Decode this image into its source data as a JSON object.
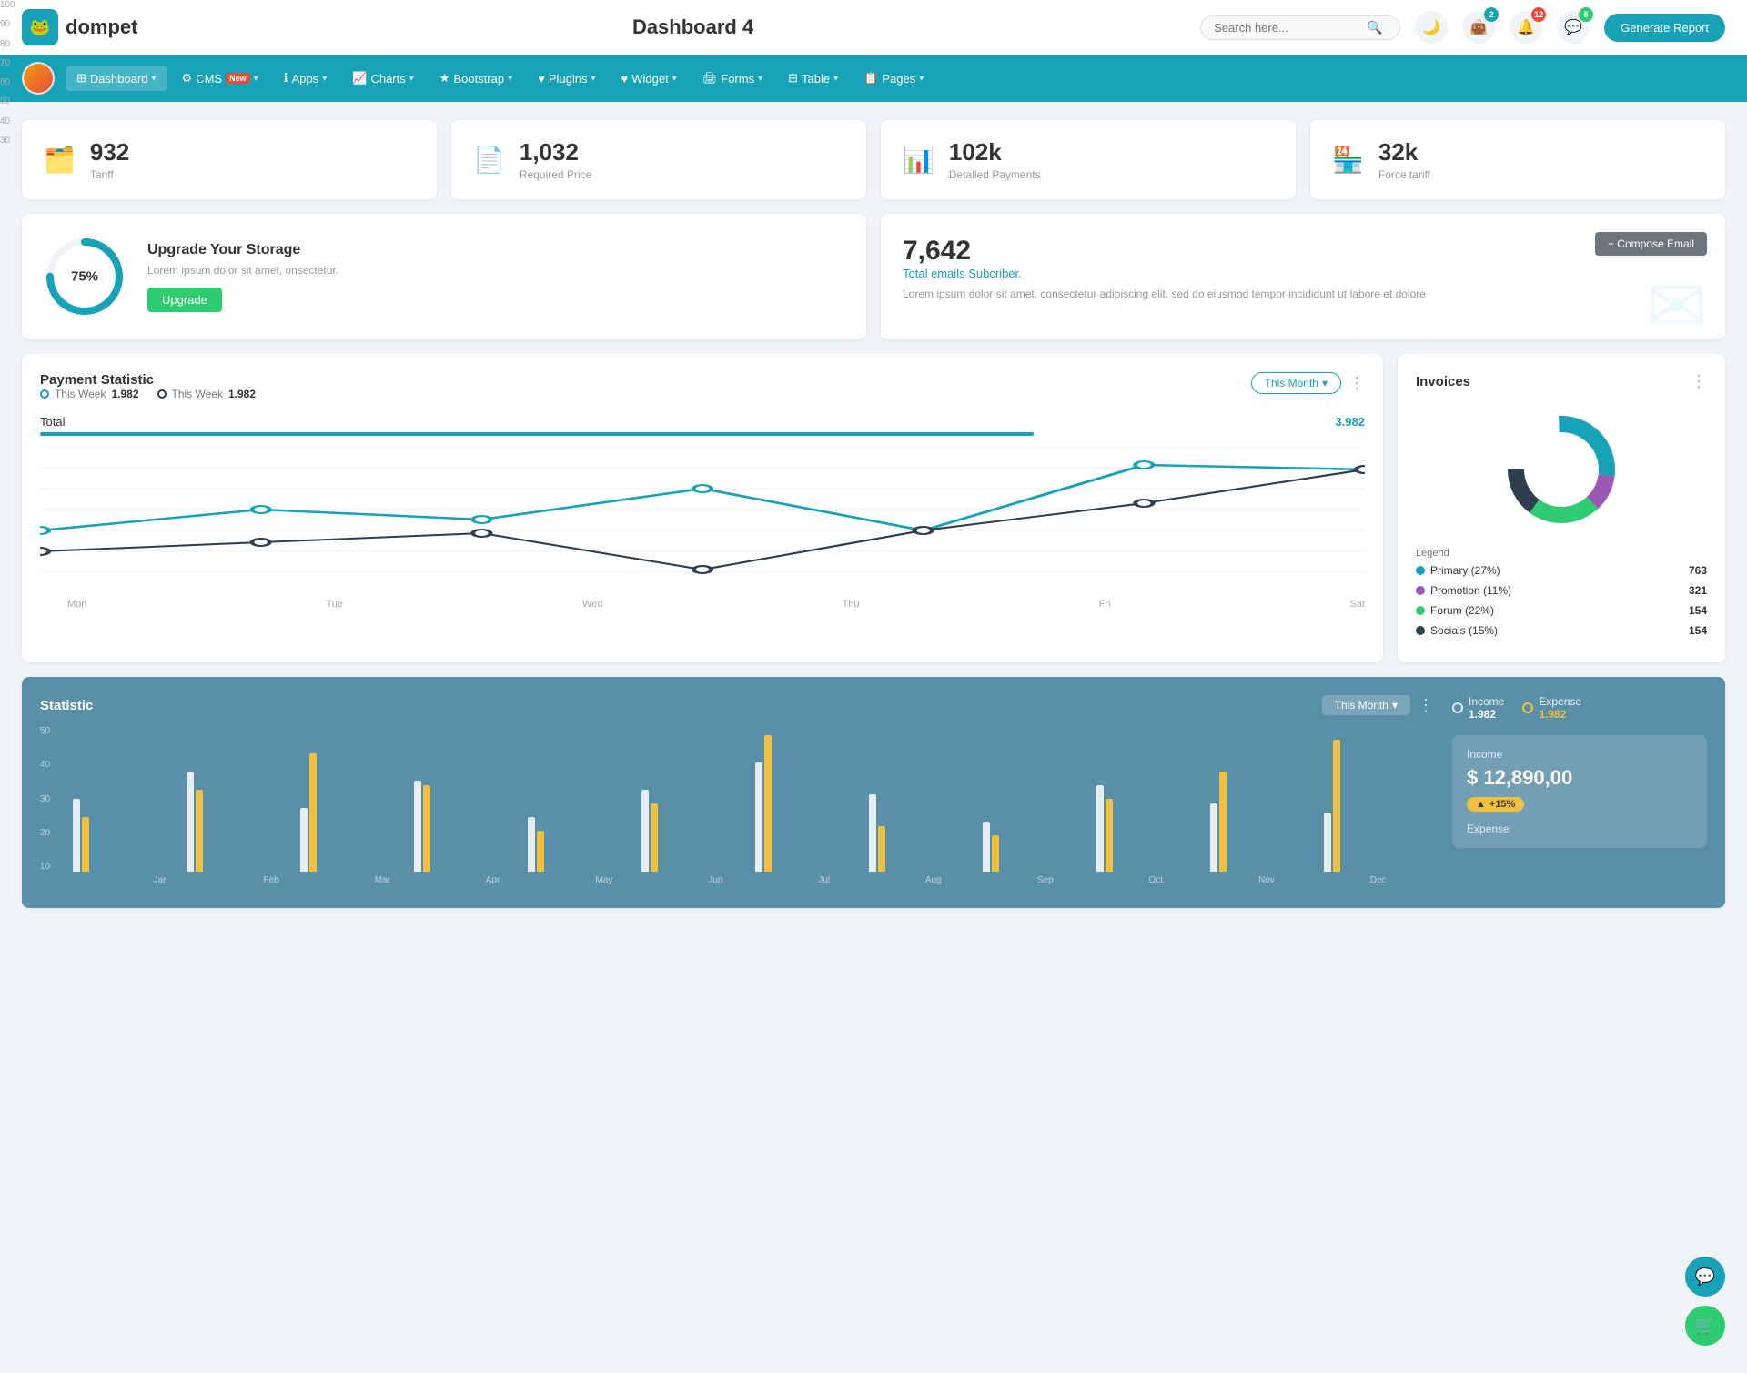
{
  "header": {
    "logo_text": "dompet",
    "title": "Dashboard 4",
    "search_placeholder": "Search here...",
    "generate_btn": "Generate Report",
    "icons": {
      "bag_badge": "2",
      "bell_badge": "12",
      "chat_badge": "5"
    }
  },
  "navbar": {
    "items": [
      {
        "id": "dashboard",
        "label": "Dashboard",
        "active": true,
        "has_arrow": true
      },
      {
        "id": "cms",
        "label": "CMS",
        "badge": "New",
        "has_arrow": true
      },
      {
        "id": "apps",
        "label": "Apps",
        "has_arrow": true
      },
      {
        "id": "charts",
        "label": "Charts",
        "has_arrow": true
      },
      {
        "id": "bootstrap",
        "label": "Bootstrap",
        "has_arrow": true
      },
      {
        "id": "plugins",
        "label": "Plugins",
        "has_arrow": true
      },
      {
        "id": "widget",
        "label": "Widget",
        "has_arrow": true
      },
      {
        "id": "forms",
        "label": "Forms",
        "has_arrow": true
      },
      {
        "id": "table",
        "label": "Table",
        "has_arrow": true
      },
      {
        "id": "pages",
        "label": "Pages",
        "has_arrow": true
      }
    ]
  },
  "stat_cards": [
    {
      "id": "tariff",
      "value": "932",
      "label": "Tariff",
      "icon": "🗂️",
      "color": "teal"
    },
    {
      "id": "required-price",
      "value": "1,032",
      "label": "Required Price",
      "icon": "📄",
      "color": "red"
    },
    {
      "id": "detailed-payments",
      "value": "102k",
      "label": "Detalled Payments",
      "icon": "📊",
      "color": "purple"
    },
    {
      "id": "force-tariff",
      "value": "32k",
      "label": "Force tariff",
      "icon": "🏪",
      "color": "pink"
    }
  ],
  "storage": {
    "percent": 75,
    "title": "Upgrade Your Storage",
    "description": "Lorem ipsum dolor sit amet, onsectetur.",
    "btn_label": "Upgrade"
  },
  "email": {
    "count": "7,642",
    "subtitle": "Total emails Subcriber.",
    "description": "Lorem ipsum dolor sit amet, consectetur adipiscing elit, sed do eiusmod tempor incididunt ut labore et dolore",
    "compose_btn": "+ Compose Email"
  },
  "payment_chart": {
    "title": "Payment Statistic",
    "period_btn": "This Month",
    "legend": [
      {
        "label": "This Week",
        "value": "1.982",
        "type": "teal"
      },
      {
        "label": "This Week",
        "value": "1.982",
        "type": "dark"
      }
    ],
    "total_label": "Total",
    "total_value": "3.982",
    "x_labels": [
      "Mon",
      "Tue",
      "Wed",
      "Thu",
      "Fri",
      "Sat"
    ],
    "y_labels": [
      "100",
      "90",
      "80",
      "70",
      "60",
      "50",
      "40",
      "30"
    ]
  },
  "invoices": {
    "title": "Invoices",
    "legend_title": "Legend",
    "items": [
      {
        "label": "Primary (27%)",
        "color": "#17a2b8",
        "count": "763"
      },
      {
        "label": "Promotion (11%)",
        "color": "#9b59b6",
        "count": "321"
      },
      {
        "label": "Forum (22%)",
        "color": "#2ecc71",
        "count": "154"
      },
      {
        "label": "Socials (15%)",
        "color": "#2c3e50",
        "count": "154"
      }
    ]
  },
  "statistic": {
    "title": "Statistic",
    "period_btn": "This Month",
    "y_labels": [
      "50",
      "40",
      "30",
      "20",
      "10"
    ],
    "x_labels": [
      "Jan",
      "Feb",
      "Mar",
      "Apr",
      "May",
      "Jun",
      "Jul",
      "Aug",
      "Sep",
      "Oct",
      "Nov",
      "Dec"
    ],
    "legend": [
      {
        "label": "Income",
        "value": "1.982",
        "type": "white"
      },
      {
        "label": "Expense",
        "value": "1.982",
        "type": "yellow"
      }
    ],
    "income": {
      "label": "Income",
      "value": "$ 12,890,00",
      "badge": "+15%"
    },
    "expense_label": "Expense"
  }
}
